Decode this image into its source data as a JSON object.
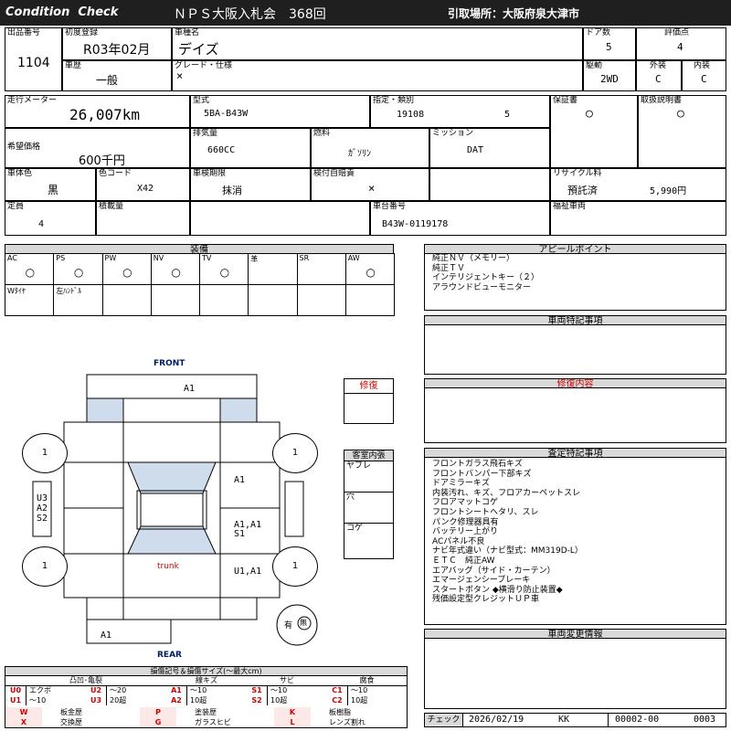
{
  "header": {
    "badge": "Condition  Check",
    "title": "ＮＰＳ大阪入札会　368回",
    "pickup": "引取場所：大阪府泉大津市"
  },
  "basic": {
    "lot_label": "出品番号",
    "lot": "1104",
    "first_reg_label": "初度登録",
    "first_reg": "R03年02月",
    "model_label": "車種名",
    "model": "デイズ",
    "doors_label": "ドア数",
    "doors": "5",
    "score_label": "評価点",
    "score": "4",
    "history_label": "車歴",
    "history": "一般",
    "grade_label": "グレード・仕様",
    "grade": "×",
    "drive_label": "駆動",
    "drive": "2WD",
    "exterior_label": "外装",
    "exterior": "C",
    "interior_label": "内装",
    "interior": "C"
  },
  "specs": {
    "mileage_label": "走行メーター",
    "mileage": "26,007km",
    "type_label": "型式",
    "type": "5BA-B43W",
    "designation_label": "指定・類別",
    "designation": "19108",
    "class_no": "5",
    "warranty_label": "保証書",
    "warranty": "○",
    "manual_label": "取扱説明書",
    "manual": "○",
    "price_label": "希望価格",
    "price": "600千円",
    "displacement_label": "排気量",
    "displacement": "660CC",
    "fuel_label": "燃料",
    "fuel": "ｶﾞｿﾘﾝ",
    "mission_label": "ミッション",
    "mission": "DAT",
    "color_label": "車体色",
    "color": "黒",
    "color_code_label": "色コード",
    "color_code": "X42",
    "inspection_label": "車検期限",
    "inspection": "抹消",
    "liability_label": "検付自賠責",
    "liability": "×",
    "recycle_label": "リサイクル料",
    "recycle_status": "預託済",
    "recycle_fee": "5,990円",
    "capacity_label": "定員",
    "capacity": "4",
    "load_label": "積載量",
    "load": "",
    "chassis_label": "車台番号",
    "chassis": "B43W-0119178",
    "welfare_label": "福祉車両",
    "welfare": ""
  },
  "equipment": {
    "title": "装備",
    "items": [
      {
        "label": "AC",
        "mark": "○"
      },
      {
        "label": "PS",
        "mark": "○"
      },
      {
        "label": "PW",
        "mark": "○"
      },
      {
        "label": "NV",
        "mark": "○"
      },
      {
        "label": "TV",
        "mark": "○"
      },
      {
        "label": "革",
        "mark": ""
      },
      {
        "label": "SR",
        "mark": ""
      },
      {
        "label": "AW",
        "mark": "○"
      }
    ],
    "row2": [
      {
        "label": "Wﾀｲﾔ"
      },
      {
        "label": "左ﾊﾝﾄﾞﾙ"
      }
    ]
  },
  "appeal": {
    "title": "アピールポイント",
    "lines": [
      "純正ＮＶ（メモリー）",
      "純正ＴＶ",
      "インテリジェントキー（２）",
      "アラウンドビューモニター"
    ]
  },
  "special": {
    "title": "車両特記事項"
  },
  "repair_content": {
    "title": "修復内容"
  },
  "inspection_notes": {
    "title": "査定特記事項",
    "lines": [
      "フロントガラス飛石キズ",
      "フロントバンパー下部キズ",
      "ドアミラーキズ",
      "内装汚れ、キズ、フロアカーペットスレ",
      "フロアマットコゲ",
      "フロントシートヘタリ、スレ",
      "パンク修理器具有",
      "バッテリー上がり",
      "ACパネル不良",
      "ナビ年式違い（ナビ型式：MM319D-L）",
      "ＥＴＣ　純正AW",
      "エアバッグ（サイド・カーテン）",
      "エマージェンシーブレーキ",
      "スタートボタン ◆横滑り防止装置◆",
      "残価設定型クレジットＵＰ車"
    ]
  },
  "changes": {
    "title": "車両変更情報"
  },
  "diagram": {
    "front": "FRONT",
    "rear": "REAR",
    "trunk": "trunk",
    "top_mark": "A1",
    "bottom_mark": "A1",
    "tire_fl": "1",
    "tire_fr": "1",
    "tire_rl": "1",
    "tire_rr": "1",
    "left_mark_1": "U3",
    "left_mark_2": "A2",
    "left_mark_3": "S2",
    "right_mark_1": "A1",
    "right_mark_2": "A1,A1",
    "right_mark_3": "S1",
    "right_mark_4": "U1,A1",
    "spare_label": "有",
    "spare_mark": "無",
    "repair_label": "修復",
    "interior_title": "客室内張",
    "interior_rows": [
      "ヤブレ",
      "穴",
      "コゲ"
    ]
  },
  "legend": {
    "title": "損傷記号＆損傷サイズ(～最大cm)",
    "groups": [
      "凸凹･亀裂",
      "線キズ",
      "サビ",
      "腐食"
    ],
    "rows": [
      {
        "c1": "U0",
        "t1": "エクボ",
        "c2": "U2",
        "t2": "～20",
        "c3": "A1",
        "t3": "～10",
        "c4": "S1",
        "t4": "～10",
        "c5": "C1",
        "t5": "～10"
      },
      {
        "c1": "U1",
        "t1": "～10",
        "c2": "U3",
        "t2": "20超",
        "c3": "A2",
        "t3": "10超",
        "c4": "S2",
        "t4": "10超",
        "c5": "C2",
        "t5": "10超"
      }
    ],
    "rows2": [
      {
        "c1": "W",
        "t1": "板金歴",
        "c2": "P",
        "t2": "塗装歴",
        "c3": "K",
        "t3": "板樹脂"
      },
      {
        "c1": "X",
        "t1": "交換歴",
        "c2": "G",
        "t2": "ガラスヒビ",
        "c3": "L",
        "t3": "レンズ割れ"
      }
    ]
  },
  "footer": {
    "check_label": "チェック",
    "date": "2026/02/19",
    "inspector": "KK",
    "code1": "00002-00",
    "code2": "0003"
  },
  "colors": {
    "badge": "#1f1f1f",
    "red": "#cc0000",
    "header_gray": "#d9d9d9",
    "diagram_fill": "#cfdcec",
    "navy": "#001a66"
  }
}
